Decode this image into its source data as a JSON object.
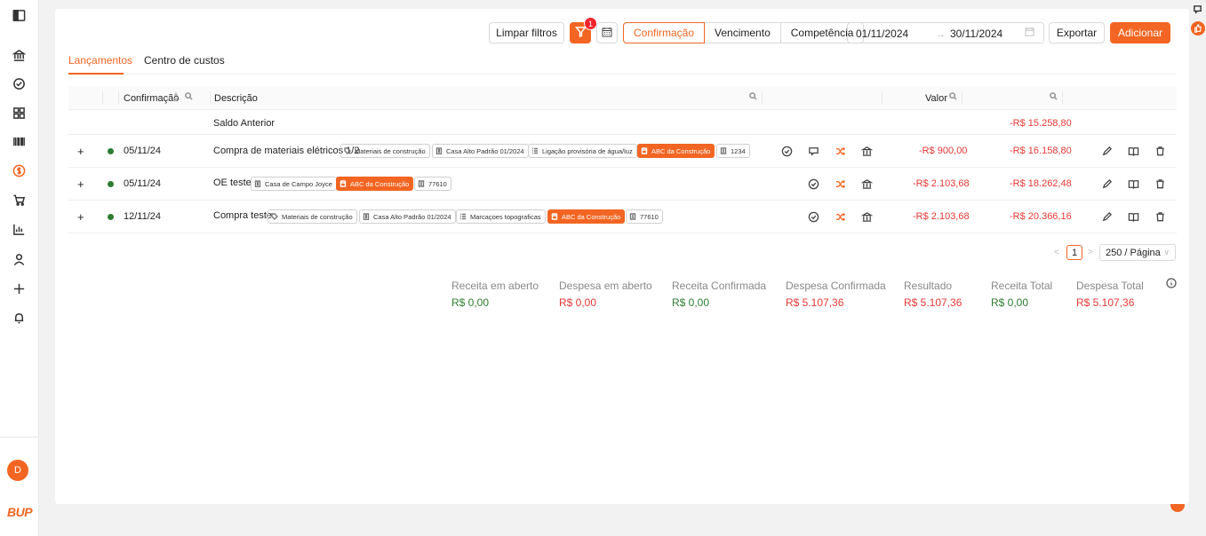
{
  "toolbar": {
    "clear_filters": "Limpar filtros",
    "filter_count": "1",
    "date_modes": [
      "Confirmação",
      "Vencimento",
      "Competência"
    ],
    "date_from": "01/11/2024",
    "date_to": "30/11/2024",
    "export": "Exportar",
    "add": "Adicionar"
  },
  "tabs": [
    "Lançamentos",
    "Centro de custos"
  ],
  "table": {
    "headers": {
      "confirmation": "Confirmação",
      "description": "Descrição",
      "value": "Valor"
    },
    "saldo": {
      "label": "Saldo Anterior",
      "balance": "-R$ 15.258,80"
    },
    "rows": [
      {
        "expand": "+",
        "date": "05/11/24",
        "description": "Compra de materiais elétricos 1/2",
        "tags": [
          "Materiais de construção",
          "Casa Alto Padrão 01/2024",
          "Ligação provisória de água/luz",
          "ABC da Construção",
          "1234"
        ],
        "value": "-R$ 900,00",
        "balance": "-R$ 16.158,80"
      },
      {
        "expand": "+",
        "date": "05/11/24",
        "description": "OE teste",
        "tags": [
          "Casa de Campo Joyce",
          "ABC da Construção",
          "77610"
        ],
        "value": "-R$ 2.103,68",
        "balance": "-R$ 18.262,48"
      },
      {
        "expand": "+",
        "date": "12/11/24",
        "description": "Compra teste",
        "tags": [
          "Materiais de construção",
          "Casa Alto Padrão 01/2024",
          "Marcaçoes topograficas",
          "ABC da Construção",
          "77610"
        ],
        "value": "-R$ 2.103,68",
        "balance": "-R$ 20.366,16"
      }
    ]
  },
  "pagination": {
    "page": "1",
    "page_size": "250 / Página"
  },
  "summary": [
    {
      "label": "Receita em aberto",
      "value": "R$ 0,00"
    },
    {
      "label": "Despesa em aberto",
      "value": "R$ 0,00"
    },
    {
      "label": "Receita Confirmada",
      "value": "R$ 0,00"
    },
    {
      "label": "Despesa Confirmada",
      "value": "R$ 5.107,36"
    },
    {
      "label": "Resultado",
      "value": "R$ 5.107,36"
    },
    {
      "label": "Receita Total",
      "value": "R$ 0,00"
    },
    {
      "label": "Despesa Total",
      "value": "R$ 5.107,36"
    }
  ],
  "user": {
    "initial": "D"
  },
  "brand": {
    "logo": "BUP"
  },
  "colors": {
    "accent": "#f26522",
    "negative": "#e53935",
    "positive": "#2e7d32"
  },
  "icons": [
    "sidebar-toggle-icon",
    "bank-icon",
    "check-circle-icon",
    "grid-icon",
    "barcode-icon",
    "dollar-icon",
    "cart-icon",
    "bar-chart-icon",
    "user-icon",
    "plus-icon",
    "bell-icon",
    "filter-icon",
    "calendar-icon",
    "edit-icon",
    "book-icon",
    "trash-icon"
  ]
}
